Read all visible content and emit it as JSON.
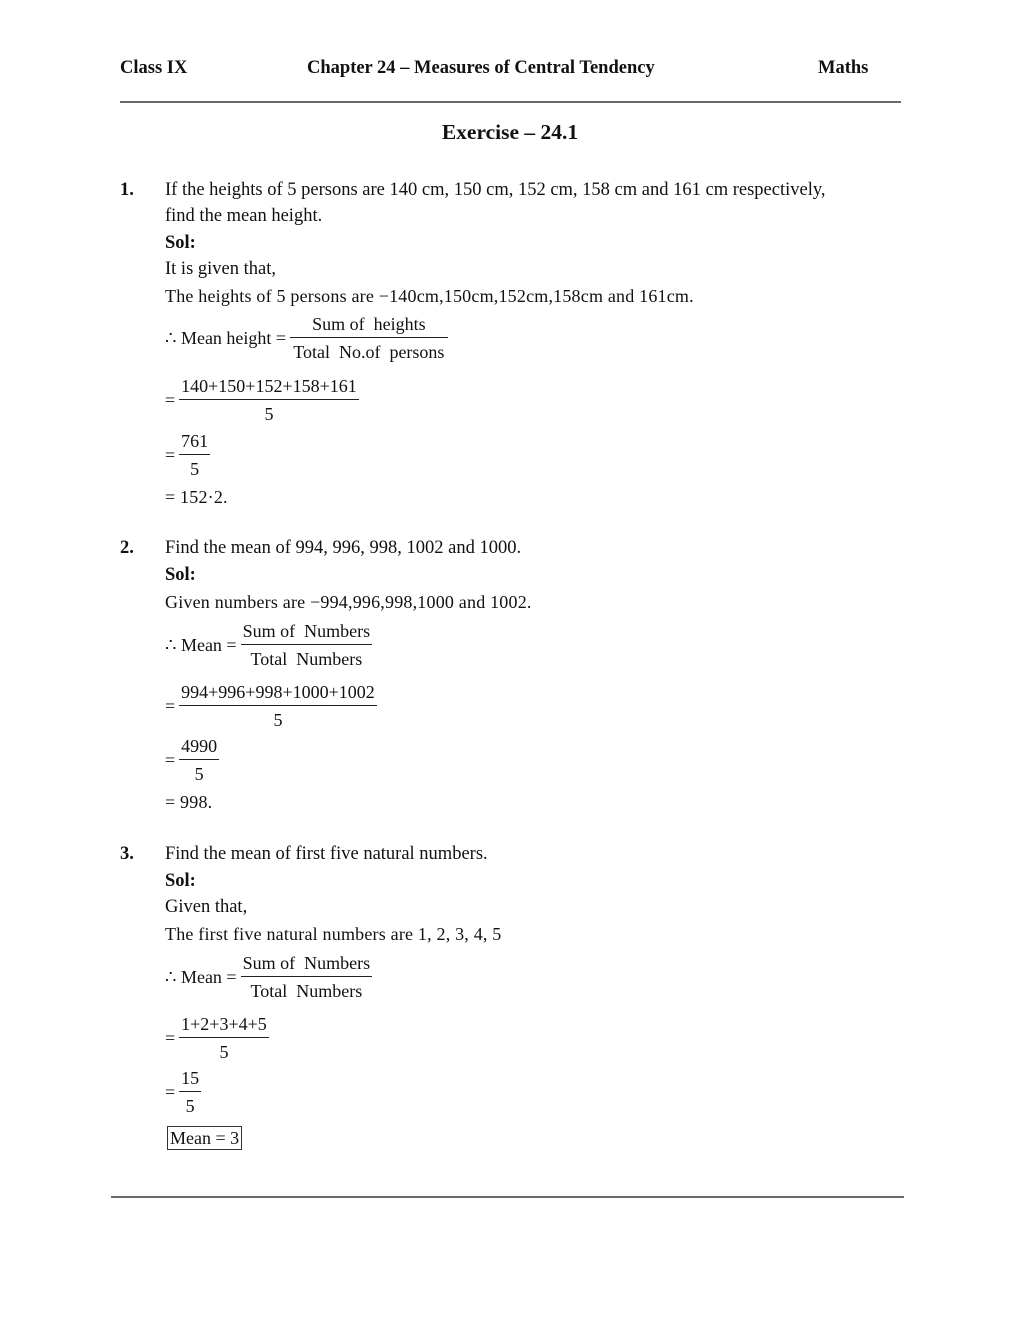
{
  "header": {
    "class": "Class IX",
    "chapter": "Chapter 24 – Measures of Central Tendency",
    "subject": "Maths"
  },
  "exercise_title": "Exercise – 24.1",
  "questions": [
    {
      "number": "1.",
      "question_line1": "If the heights of 5 persons are 140 cm, 150 cm, 152 cm, 158 cm and 161 cm respectively,",
      "question_line2": "find the mean height.",
      "sol_label": "Sol:",
      "given_line1": "It is given that,",
      "given_line2": "The heights of 5 persons are −140cm,150cm,152cm,158cm and 161cm.",
      "formula_lhs": "∴ Mean height =",
      "formula_num": "Sum of  heights",
      "formula_den": "Total  No.of  persons",
      "step1_num": "140+150+152+158+161",
      "step1_den": "5",
      "step2_num": "761",
      "step2_den": "5",
      "result": "= 152·2."
    },
    {
      "number": "2.",
      "question_line1": "Find the mean of 994, 996, 998, 1002 and 1000.",
      "sol_label": "Sol:",
      "given_line1": "Given numbers are −994,996,998,1000 and 1002.",
      "formula_lhs": "∴ Mean =",
      "formula_num": "Sum of  Numbers",
      "formula_den": "Total  Numbers",
      "step1_num": "994+996+998+1000+1002",
      "step1_den": "5",
      "step2_num": "4990",
      "step2_den": "5",
      "result": "= 998."
    },
    {
      "number": "3.",
      "question_line1": "Find the mean of first five natural numbers.",
      "sol_label": "Sol:",
      "given_line1": "Given that,",
      "given_line2": "The first five natural numbers are 1, 2, 3, 4, 5",
      "formula_lhs": "∴ Mean =",
      "formula_num": "Sum of  Numbers",
      "formula_den": "Total  Numbers",
      "step1_num": "1+2+3+4+5",
      "step1_den": "5",
      "step2_num": "15",
      "step2_den": "5",
      "result": "Mean = 3"
    }
  ],
  "equals_sign": "="
}
